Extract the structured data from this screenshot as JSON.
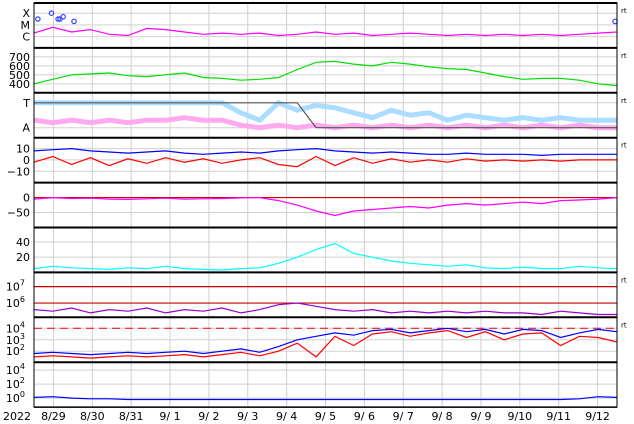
{
  "chart_data": {
    "type": "line",
    "title": "",
    "x_start_label": "2022",
    "x_tick_labels": [
      "8/29",
      "8/30",
      "8/31",
      "9/ 1",
      "9/ 2",
      "9/ 3",
      "9/ 4",
      "9/ 5",
      "9/ 6",
      "9/ 7",
      "9/ 8",
      "9/ 9",
      "9/10",
      "9/11",
      "9/12"
    ],
    "x_range_days": [
      0,
      15
    ],
    "x_tick_days": [
      0.5,
      1.5,
      2.5,
      3.5,
      4.5,
      5.5,
      6.5,
      7.5,
      8.5,
      9.5,
      10.5,
      11.5,
      12.5,
      13.5,
      14.5
    ],
    "right_marker": "rt",
    "panels": [
      {
        "name": "xray",
        "scale": "log",
        "ylim": [
          -6.96,
          -3.13
        ],
        "ticks": [
          {
            "v": -4,
            "label": "X"
          },
          {
            "v": -5,
            "label": "M"
          },
          {
            "v": -6,
            "label": "C"
          }
        ],
        "rt": true,
        "refs": [],
        "series": [
          {
            "name": "X-ray flux",
            "color": "#ff00ff",
            "values": [
              -5.7,
              -5.2,
              -5.6,
              -5.4,
              -5.8,
              -5.9,
              -5.3,
              -5.4,
              -5.6,
              -5.8,
              -5.7,
              -5.8,
              -5.7,
              -5.9,
              -5.8,
              -5.6,
              -5.8,
              -5.7,
              -5.9,
              -5.8,
              -5.7,
              -5.8,
              -5.9,
              -5.8,
              -5.9,
              -5.8,
              -5.9,
              -5.8,
              -5.9,
              -5.8,
              -5.7,
              -5.6
            ]
          }
        ],
        "flares": [
          {
            "day": 0.1,
            "v": -4.5
          },
          {
            "day": 0.45,
            "v": -4.0
          },
          {
            "day": 0.62,
            "v": -4.5
          },
          {
            "day": 0.67,
            "v": -4.5
          },
          {
            "day": 0.75,
            "v": -4.3
          },
          {
            "day": 1.03,
            "v": -4.7
          },
          {
            "day": 14.95,
            "v": -4.7
          }
        ]
      },
      {
        "name": "solar-wind-speed",
        "scale": "linear",
        "ylim": [
          300,
          800
        ],
        "ticks": [
          {
            "v": 700,
            "label": "700"
          },
          {
            "v": 600,
            "label": "600"
          },
          {
            "v": 500,
            "label": "500"
          },
          {
            "v": 400,
            "label": "400"
          }
        ],
        "rt": true,
        "refs": [],
        "series": [
          {
            "name": "Speed",
            "color": "#00e000",
            "values": [
              400,
              450,
              500,
              510,
              520,
              490,
              480,
              500,
              520,
              470,
              460,
              440,
              450,
              470,
              560,
              640,
              650,
              620,
              600,
              640,
              620,
              590,
              570,
              560,
              520,
              480,
              450,
              460,
              460,
              440,
              400,
              380
            ]
          }
        ]
      },
      {
        "name": "imf-sector",
        "scale": "linear",
        "ylim": [
          -0.4,
          1.4
        ],
        "ticks": [
          {
            "v": 1,
            "label": "T"
          },
          {
            "v": 0,
            "label": "A"
          }
        ],
        "rt": true,
        "refs": [],
        "series": [
          {
            "name": "T",
            "color": "#aaddff",
            "values": [
              1,
              1,
              1,
              1,
              1,
              1,
              1,
              1,
              1,
              1,
              1,
              0.6,
              0.3,
              1,
              0.7,
              0.9,
              0.8,
              0.6,
              0.4,
              0.7,
              0.5,
              0.6,
              0.3,
              0.5,
              0.4,
              0.3,
              0.4,
              0.3,
              0.4,
              0.3,
              0.3,
              0.3
            ]
          },
          {
            "name": "A",
            "color": "#ffaaee",
            "values": [
              0.3,
              0.2,
              0.3,
              0.2,
              0.3,
              0.2,
              0.3,
              0.3,
              0.4,
              0.3,
              0.3,
              0.1,
              0,
              0.1,
              0,
              0.1,
              0,
              0.1,
              0,
              0.1,
              0,
              0.1,
              0,
              0.1,
              0,
              0.1,
              0,
              0.1,
              0,
              0.1,
              0,
              0
            ]
          },
          {
            "name": "Sector",
            "color": "#555555",
            "values": [
              1,
              1,
              1,
              1,
              1,
              1,
              1,
              1,
              1,
              1,
              1,
              1,
              1,
              1,
              1,
              0,
              0,
              0,
              0,
              0,
              0,
              0,
              0,
              0,
              0,
              0,
              0,
              0,
              0,
              0,
              0,
              0
            ]
          }
        ]
      },
      {
        "name": "imf",
        "scale": "linear",
        "ylim": [
          -20,
          19.6
        ],
        "ticks": [
          {
            "v": 10,
            "label": "10"
          },
          {
            "v": 0,
            "label": "0"
          },
          {
            "v": -10,
            "label": "−10"
          }
        ],
        "rt": true,
        "refs": [],
        "series": [
          {
            "name": "Bt",
            "color": "#0000ff",
            "values": [
              8,
              9,
              10,
              8,
              7,
              6,
              7,
              8,
              6,
              5,
              6,
              7,
              6,
              8,
              9,
              10,
              8,
              7,
              6,
              7,
              6,
              5,
              5,
              6,
              5,
              5,
              5,
              4,
              5,
              5,
              5,
              5
            ]
          },
          {
            "name": "Bz",
            "color": "#ff0000",
            "values": [
              -2,
              3,
              -4,
              2,
              -5,
              1,
              -3,
              2,
              -2,
              1,
              -3,
              0,
              2,
              -4,
              -6,
              3,
              -5,
              2,
              -3,
              1,
              -2,
              0,
              -2,
              1,
              -1,
              0,
              -1,
              0,
              -1,
              0,
              0,
              0
            ]
          }
        ]
      },
      {
        "name": "dst",
        "scale": "linear",
        "ylim": [
          -100,
          50
        ],
        "ticks": [
          {
            "v": 0,
            "label": "0"
          },
          {
            "v": -50,
            "label": "−50"
          }
        ],
        "rt": false,
        "refs": [
          {
            "v": 0,
            "color": "#cc0000",
            "dash": false
          }
        ],
        "series": [
          {
            "name": "Dst",
            "color": "#ff00ff",
            "values": [
              -5,
              0,
              -3,
              -2,
              -5,
              -6,
              -4,
              -2,
              -5,
              -4,
              -3,
              -1,
              0,
              -10,
              -25,
              -45,
              -60,
              -45,
              -40,
              -35,
              -30,
              -35,
              -25,
              -20,
              -25,
              -20,
              -15,
              -20,
              -10,
              -8,
              -5,
              0
            ]
          }
        ]
      },
      {
        "name": "ae",
        "scale": "linear",
        "ylim": [
          0,
          59
        ],
        "ticks": [
          {
            "v": 40,
            "label": "40"
          },
          {
            "v": 20,
            "label": "20"
          }
        ],
        "rt": false,
        "refs": [],
        "series": [
          {
            "name": "Index",
            "color": "#00ffff",
            "values": [
              5,
              8,
              6,
              5,
              4,
              6,
              5,
              8,
              5,
              4,
              3,
              5,
              6,
              12,
              20,
              30,
              38,
              25,
              20,
              15,
              12,
              10,
              8,
              10,
              6,
              5,
              7,
              5,
              5,
              8,
              6,
              5
            ]
          }
        ]
      },
      {
        "name": "electron-flux",
        "scale": "log",
        "ylim": [
          5.13,
          7.87
        ],
        "ticks": [
          {
            "v": 7,
            "label": "10",
            "exp": "7"
          },
          {
            "v": 6,
            "label": "10",
            "exp": "6"
          }
        ],
        "rt": true,
        "refs": [
          {
            "v": 7,
            "color": "#cc0000",
            "dash": false
          },
          {
            "v": 6,
            "color": "#cc0000",
            "dash": false
          }
        ],
        "series": [
          {
            "name": "Electrons",
            "color": "#9900cc",
            "values": [
              5.6,
              5.5,
              5.7,
              5.4,
              5.6,
              5.5,
              5.7,
              5.4,
              5.6,
              5.5,
              5.7,
              5.4,
              5.6,
              5.9,
              6.0,
              5.8,
              5.6,
              5.5,
              5.6,
              5.4,
              5.5,
              5.4,
              5.5,
              5.4,
              5.5,
              5.4,
              5.4,
              5.3,
              5.5,
              5.4,
              5.3,
              5.3
            ]
          }
        ]
      },
      {
        "name": "proton-flux",
        "scale": "log",
        "ylim": [
          1.04,
          4.96
        ],
        "ticks": [
          {
            "v": 4,
            "label": "10",
            "exp": "4"
          },
          {
            "v": 3,
            "label": "10",
            "exp": "3"
          },
          {
            "v": 2,
            "label": "10",
            "exp": "2"
          }
        ],
        "rt": true,
        "refs": [
          {
            "v": 4,
            "color": "#ee2222",
            "dash": true
          }
        ],
        "series": [
          {
            "name": "High",
            "color": "#0000ff",
            "values": [
              1.8,
              1.9,
              1.8,
              1.7,
              1.8,
              1.9,
              1.8,
              1.9,
              2.0,
              1.8,
              2.0,
              2.2,
              1.9,
              2.4,
              3.0,
              3.3,
              3.6,
              3.4,
              3.8,
              3.9,
              3.6,
              3.8,
              4.0,
              3.7,
              3.9,
              3.5,
              3.9,
              3.8,
              3.2,
              3.6,
              3.9,
              3.7
            ]
          },
          {
            "name": "Low",
            "color": "#ff0000",
            "values": [
              1.5,
              1.6,
              1.5,
              1.4,
              1.5,
              1.6,
              1.5,
              1.6,
              1.7,
              1.5,
              1.7,
              1.9,
              1.6,
              2.0,
              2.7,
              1.5,
              3.3,
              2.5,
              3.5,
              3.7,
              3.3,
              3.6,
              3.8,
              3.2,
              3.7,
              3.0,
              3.5,
              3.6,
              2.5,
              3.3,
              3.2,
              2.8
            ]
          }
        ]
      },
      {
        "name": "particle-flux",
        "scale": "log",
        "ylim": [
          -1.29,
          5.14
        ],
        "ticks": [
          {
            "v": 4,
            "label": "10",
            "exp": "4"
          },
          {
            "v": 2,
            "label": "10",
            "exp": "2"
          },
          {
            "v": 0,
            "label": "10",
            "exp": "0"
          }
        ],
        "rt": false,
        "refs": [],
        "series": [
          {
            "name": "Flux",
            "color": "#0000ff",
            "values": [
              0.1,
              0.2,
              0.0,
              -0.1,
              -0.1,
              -0.2,
              -0.2,
              -0.2,
              -0.2,
              -0.2,
              -0.2,
              -0.2,
              -0.2,
              -0.2,
              -0.2,
              -0.2,
              -0.2,
              -0.2,
              -0.2,
              -0.2,
              -0.2,
              -0.2,
              -0.2,
              -0.2,
              -0.2,
              -0.2,
              -0.2,
              -0.2,
              -0.2,
              -0.1,
              0.2,
              0.1
            ]
          }
        ]
      }
    ]
  }
}
